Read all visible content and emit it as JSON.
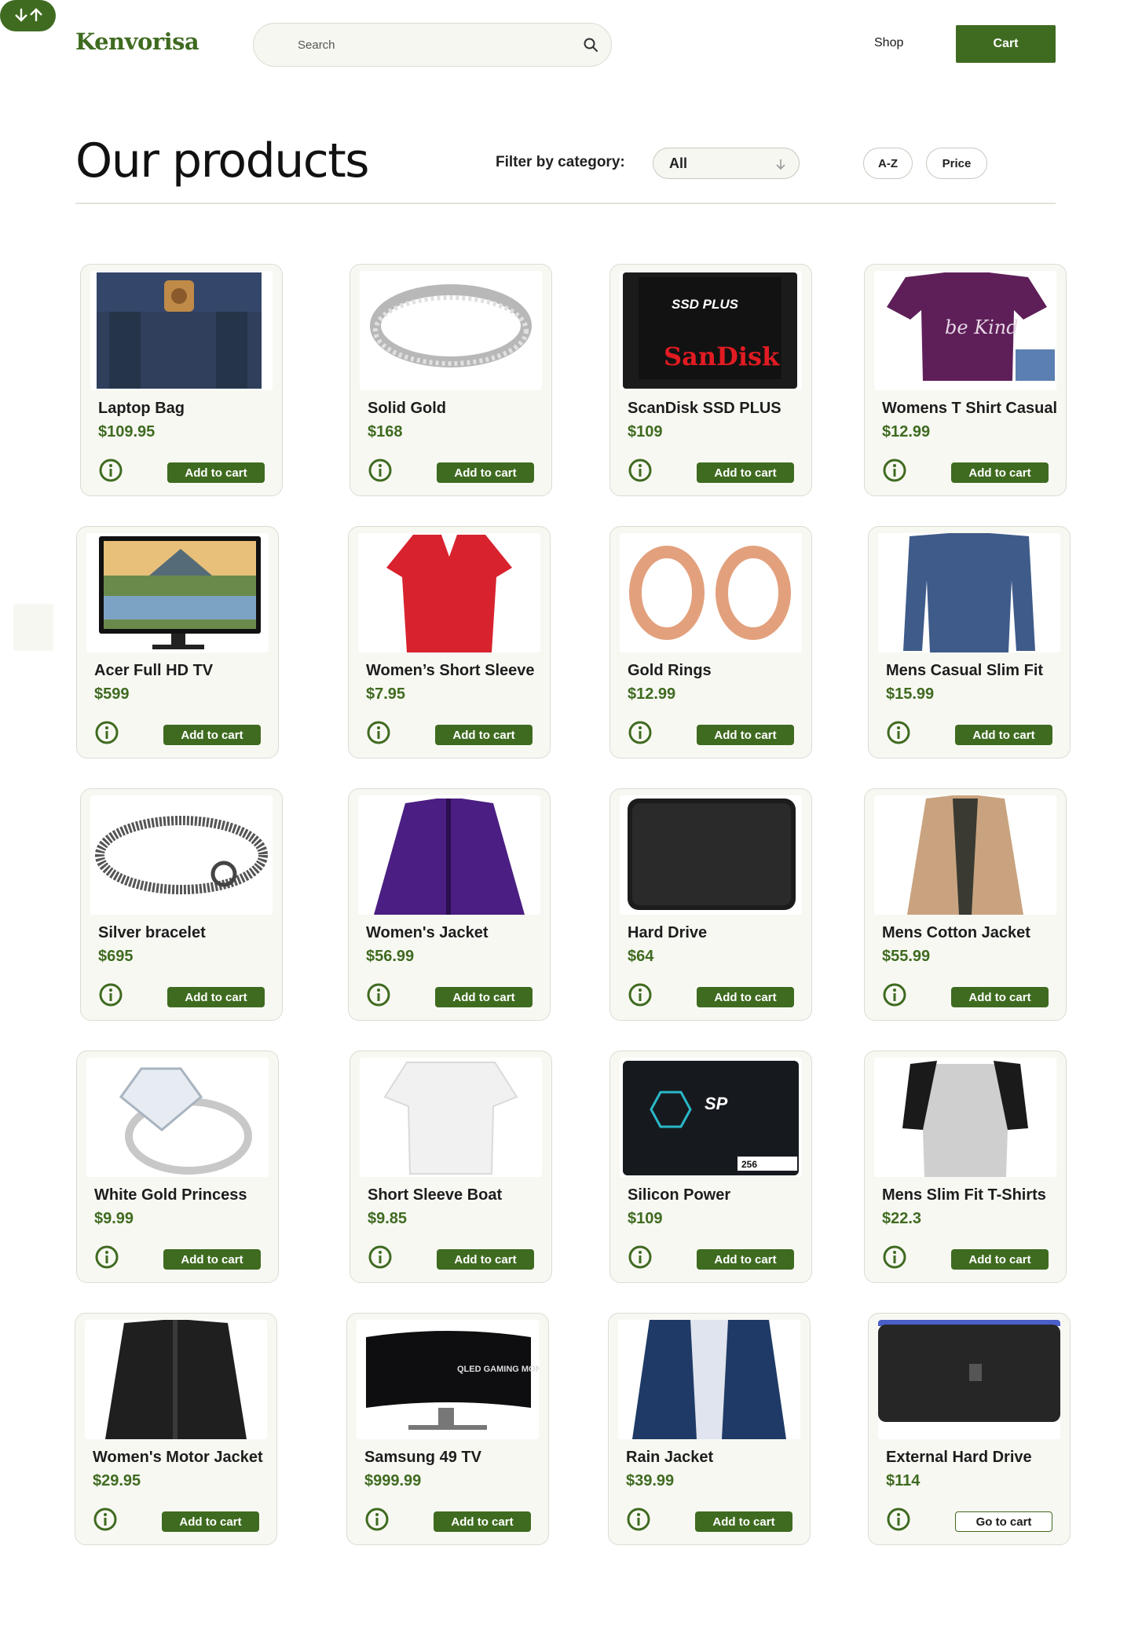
{
  "header": {
    "logo": "Kenvorisa",
    "search_placeholder": "Search",
    "shop_label": "Shop",
    "cart_label": "Cart"
  },
  "toolbar": {
    "title": "Our products",
    "filter_label": "Filter by category:",
    "filter_value": "All",
    "sort_az_label": "A-Z",
    "sort_price_label": "Price"
  },
  "colors": {
    "accent": "#3f6b20",
    "card_bg": "#f8f8f3",
    "border": "#dcdcd4"
  },
  "products": [
    {
      "name": "Laptop Bag",
      "price": "$109.95",
      "button": "Add to cart",
      "image": "laptop-bag-image"
    },
    {
      "name": "Solid Gold",
      "price": "$168",
      "button": "Add to cart",
      "image": "silver-ring-image"
    },
    {
      "name": "ScanDisk SSD PLUS",
      "price": "$109",
      "button": "Add to cart",
      "image": "ssd-image"
    },
    {
      "name": "Womens T Shirt Casual",
      "price": "$12.99",
      "button": "Add to cart",
      "image": "purple-tshirt-image"
    },
    {
      "name": "Acer Full HD  TV",
      "price": "$599",
      "button": "Add to cart",
      "image": "monitor-image"
    },
    {
      "name": "Women’s Short Sleeve",
      "price": "$7.95",
      "button": "Add to cart",
      "image": "red-shirt-image"
    },
    {
      "name": "Gold Rings",
      "price": "$12.99",
      "button": "Add to cart",
      "image": "gold-rings-image"
    },
    {
      "name": "Mens Casual Slim Fit",
      "price": "$15.99",
      "button": "Add to cart",
      "image": "blue-longsleeve-image"
    },
    {
      "name": "Silver bracelet",
      "price": "$695",
      "button": "Add to cart",
      "image": "bracelet-image"
    },
    {
      "name": "Women's Jacket",
      "price": "$56.99",
      "button": "Add to cart",
      "image": "purple-jacket-image"
    },
    {
      "name": "Hard Drive",
      "price": "$64",
      "button": "Add to cart",
      "image": "hard-drive-image"
    },
    {
      "name": "Mens Cotton Jacket",
      "price": "$55.99",
      "button": "Add to cart",
      "image": "tan-jacket-image"
    },
    {
      "name": "White Gold Princess",
      "price": "$9.99",
      "button": "Add to cart",
      "image": "diamond-ring-image"
    },
    {
      "name": "Short Sleeve Boat",
      "price": "$9.85",
      "button": "Add to cart",
      "image": "white-top-image"
    },
    {
      "name": "Silicon Power",
      "price": "$109",
      "button": "Add to cart",
      "image": "silicon-ssd-image"
    },
    {
      "name": "Mens Slim Fit T-Shirts",
      "price": "$22.3",
      "button": "Add to cart",
      "image": "raglan-shirt-image"
    },
    {
      "name": "Women's Motor Jacket",
      "price": "$29.95",
      "button": "Add to cart",
      "image": "leather-jacket-image"
    },
    {
      "name": "Samsung 49 TV",
      "price": "$999.99",
      "button": "Add to cart",
      "image": "curved-monitor-image"
    },
    {
      "name": "Rain Jacket",
      "price": "$39.99",
      "button": "Add to cart",
      "image": "rain-jacket-image"
    },
    {
      "name": "External Hard Drive",
      "price": "$114",
      "button": "Go to cart",
      "image": "external-drive-image"
    }
  ],
  "image_text": {
    "ssd_brand": "SanDisk",
    "ssd_model": "SSD PLUS",
    "tshirt_text": "be Kind",
    "monitor_text": "QLED GAMING MONITOR",
    "sp_logo": "SP",
    "sp_capacity": "256"
  }
}
